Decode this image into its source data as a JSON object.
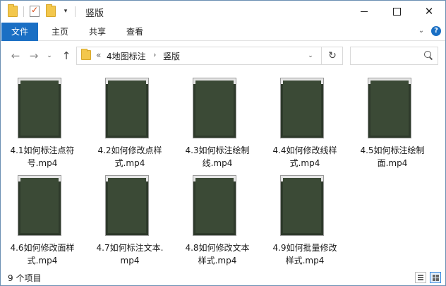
{
  "window": {
    "title": "竖版"
  },
  "ribbon": {
    "tabs": [
      "文件",
      "主页",
      "共享",
      "查看"
    ]
  },
  "address": {
    "overflow": "«",
    "crumbs": [
      "4地图标注",
      "竖版"
    ]
  },
  "files": [
    {
      "name": "4.1如何标注点符号.mp4",
      "line1": "4.1如何标注点符",
      "line2": "号.mp4"
    },
    {
      "name": "4.2如何修改点样式.mp4",
      "line1": "4.2如何修改点样",
      "line2": "式.mp4"
    },
    {
      "name": "4.3如何标注绘制线.mp4",
      "line1": "4.3如何标注绘制",
      "line2": "线.mp4"
    },
    {
      "name": "4.4如何修改线样式.mp4",
      "line1": "4.4如何修改线样",
      "line2": "式.mp4"
    },
    {
      "name": "4.5如何标注绘制面.mp4",
      "line1": "4.5如何标注绘制",
      "line2": "面.mp4"
    },
    {
      "name": "4.6如何修改面样式.mp4",
      "line1": "4.6如何修改面样",
      "line2": "式.mp4"
    },
    {
      "name": "4.7如何标注文本.mp4",
      "line1": "4.7如何标注文本.",
      "line2": "mp4"
    },
    {
      "name": "4.8如何修改文本样式.mp4",
      "line1": "4.8如何修改文本",
      "line2": "样式.mp4"
    },
    {
      "name": "4.9如何批量修改样式.mp4",
      "line1": "4.9如何批量修改",
      "line2": "样式.mp4"
    }
  ],
  "status": {
    "item_count": "9 个项目"
  },
  "colors": {
    "accent": "#1a6fc4",
    "folder": "#f3c74c"
  }
}
